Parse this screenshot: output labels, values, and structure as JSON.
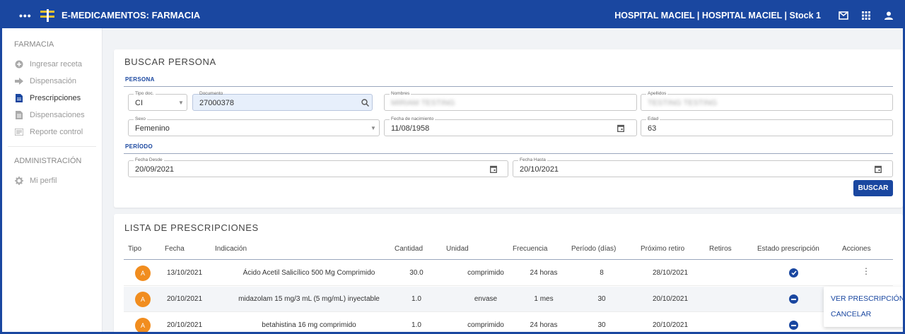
{
  "header": {
    "app_title": "E-MEDICAMENTOS: FARMACIA",
    "hospital": "HOSPITAL MACIEL | HOSPITAL MACIEL | Stock 1",
    "colors": {
      "primary": "#1a47a0",
      "accent": "#f2c230"
    }
  },
  "sidebar": {
    "section_farmacia": "FARMACIA",
    "items": [
      {
        "label": "Ingresar receta",
        "icon": "plus-circle-icon"
      },
      {
        "label": "Dispensación",
        "icon": "arrow-right-icon"
      },
      {
        "label": "Prescripciones",
        "icon": "document-icon"
      },
      {
        "label": "Dispensaciones",
        "icon": "document-list-icon"
      },
      {
        "label": "Reporte control",
        "icon": "report-icon"
      }
    ],
    "section_admin": "ADMINISTRACIÓN",
    "admin_items": [
      {
        "label": "Mi perfil",
        "icon": "gear-icon"
      }
    ]
  },
  "search": {
    "title": "BUSCAR PERSONA",
    "persona_heading": "PERSONA",
    "tipo_doc": {
      "label": "Tipo doc.",
      "value": "CI"
    },
    "documento": {
      "label": "Documento",
      "value": "27000378"
    },
    "nombres": {
      "label": "Nombres",
      "value": "MIRIAM TESTING"
    },
    "apellidos": {
      "label": "Apellidos",
      "value": "TESTING TESTING"
    },
    "sexo": {
      "label": "Sexo",
      "value": "Femenino"
    },
    "fecha_nacimiento": {
      "label": "Fecha de nacimiento",
      "value": "11/08/1958"
    },
    "edad": {
      "label": "Edad",
      "value": "63"
    },
    "periodo_heading": "PERÍODO",
    "fecha_desde": {
      "label": "Fecha Desde",
      "value": "20/09/2021"
    },
    "fecha_hasta": {
      "label": "Fecha Hasta",
      "value": "20/10/2021"
    },
    "buscar_label": "BUSCAR"
  },
  "list": {
    "title": "LISTA DE PRESCRIPCIONES",
    "columns": [
      "Tipo",
      "Fecha",
      "Indicación",
      "Cantidad",
      "Unidad",
      "Frecuencia",
      "Período (días)",
      "Próximo retiro",
      "Retiros",
      "Estado prescripción",
      "Acciones"
    ],
    "rows": [
      {
        "tipo": "A",
        "fecha": "13/10/2021",
        "indicacion": "Ácido Acetil Salicílico 500 Mg Comprimido",
        "cantidad": "30.0",
        "unidad": "comprimido",
        "frecuencia": "24 horas",
        "periodo": "8",
        "proximo": "28/10/2021",
        "retiros": "",
        "estado": "check",
        "estado_icon": "check-circle-icon"
      },
      {
        "tipo": "A",
        "fecha": "20/10/2021",
        "indicacion": "midazolam 15 mg/3 mL (5 mg/mL) inyectable",
        "cantidad": "1.0",
        "unidad": "envase",
        "frecuencia": "1 mes",
        "periodo": "30",
        "proximo": "20/10/2021",
        "retiros": "",
        "estado": "minus",
        "estado_icon": "minus-circle-icon"
      },
      {
        "tipo": "A",
        "fecha": "20/10/2021",
        "indicacion": "betahistina 16 mg comprimido",
        "cantidad": "1.0",
        "unidad": "comprimido",
        "frecuencia": "24 horas",
        "periodo": "30",
        "proximo": "20/10/2021",
        "retiros": "",
        "estado": "minus",
        "estado_icon": "minus-circle-icon"
      }
    ],
    "menu": {
      "ver": "VER PRESCRIPCIÓN",
      "cancelar": "CANCELAR"
    }
  }
}
